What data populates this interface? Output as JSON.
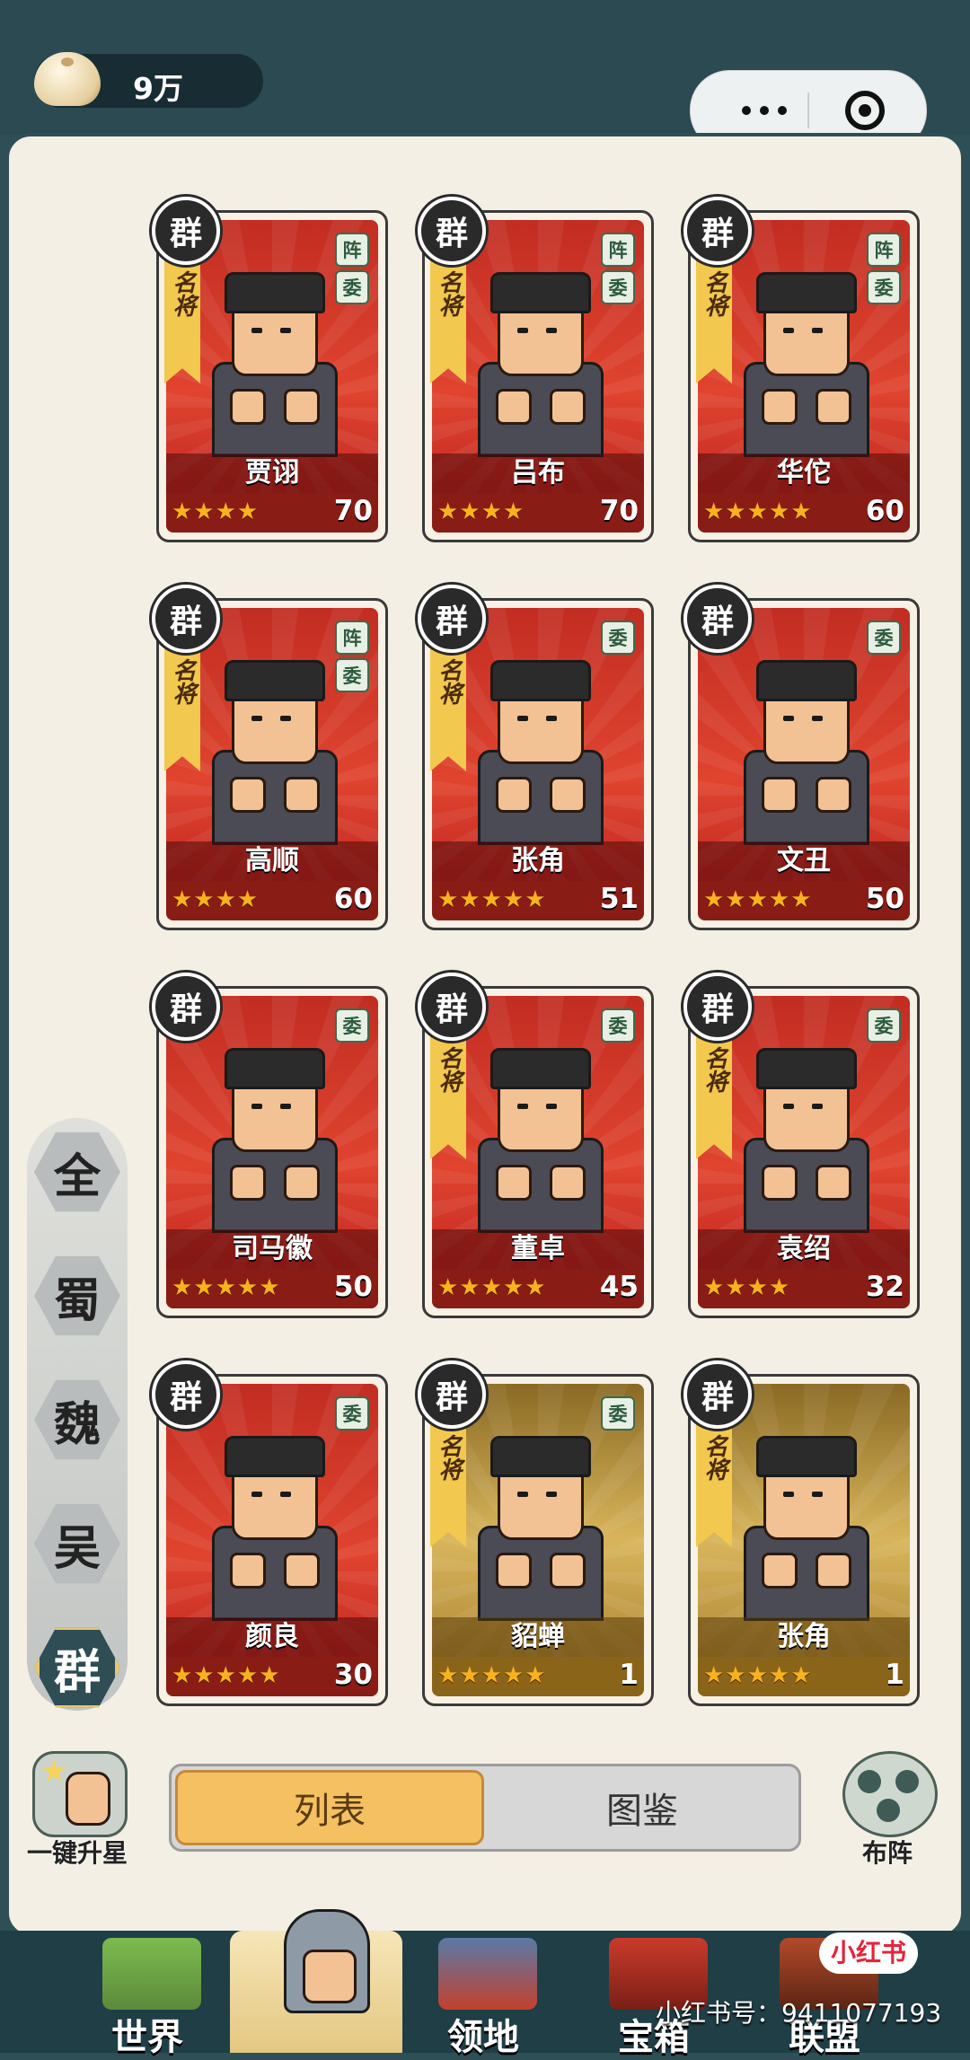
{
  "currency": {
    "value": "9万",
    "icon": "bun-icon"
  },
  "capsule": {
    "more_icon": "more-dots-icon",
    "close_icon": "target-close-icon"
  },
  "cards": [
    {
      "faction": "群",
      "ribbon": "名将",
      "tags": [
        "阵",
        "委"
      ],
      "name": "贾诩",
      "stars": "★★★★",
      "level": "70",
      "theme": "red"
    },
    {
      "faction": "群",
      "ribbon": "名将",
      "tags": [
        "阵",
        "委"
      ],
      "name": "吕布",
      "stars": "★★★★",
      "level": "70",
      "theme": "red"
    },
    {
      "faction": "群",
      "ribbon": "名将",
      "tags": [
        "阵",
        "委"
      ],
      "name": "华佗",
      "stars": "★★★★★",
      "level": "60",
      "theme": "red"
    },
    {
      "faction": "群",
      "ribbon": "名将",
      "tags": [
        "阵",
        "委"
      ],
      "name": "高顺",
      "stars": "★★★★",
      "level": "60",
      "theme": "red"
    },
    {
      "faction": "群",
      "ribbon": "名将",
      "tags": [
        "委"
      ],
      "name": "张角",
      "stars": "★★★★★",
      "level": "51",
      "theme": "red"
    },
    {
      "faction": "群",
      "ribbon": "",
      "tags": [
        "委"
      ],
      "name": "文丑",
      "stars": "★★★★★",
      "level": "50",
      "theme": "red"
    },
    {
      "faction": "群",
      "ribbon": "",
      "tags": [
        "委"
      ],
      "name": "司马徽",
      "stars": "★★★★★",
      "level": "50",
      "theme": "red"
    },
    {
      "faction": "群",
      "ribbon": "名将",
      "tags": [
        "委"
      ],
      "name": "董卓",
      "stars": "★★★★★",
      "level": "45",
      "theme": "red"
    },
    {
      "faction": "群",
      "ribbon": "名将",
      "tags": [
        "委"
      ],
      "name": "袁绍",
      "stars": "★★★★",
      "level": "32",
      "theme": "red"
    },
    {
      "faction": "群",
      "ribbon": "",
      "tags": [
        "委"
      ],
      "name": "颜良",
      "stars": "★★★★★",
      "level": "30",
      "theme": "red"
    },
    {
      "faction": "群",
      "ribbon": "名将",
      "tags": [
        "委"
      ],
      "name": "貂蝉",
      "stars": "★★★★★",
      "level": "1",
      "theme": "gold"
    },
    {
      "faction": "群",
      "ribbon": "名将",
      "tags": [],
      "name": "张角",
      "stars": "★★★★★",
      "level": "1",
      "theme": "gold"
    }
  ],
  "side_tabs": [
    {
      "label": "全",
      "active": false
    },
    {
      "label": "蜀",
      "active": false
    },
    {
      "label": "魏",
      "active": false
    },
    {
      "label": "吴",
      "active": false
    },
    {
      "label": "群",
      "active": true
    }
  ],
  "view_toggle": {
    "list": "列表",
    "gallery": "图鉴",
    "selected": "列表"
  },
  "upgrade_stars": {
    "label": "一键升星",
    "icon": "upgrade-star-icon"
  },
  "formation": {
    "label": "布阵",
    "icon": "formation-icon"
  },
  "bottom_nav": [
    {
      "label": "世界",
      "active": false
    },
    {
      "label": "",
      "active": true
    },
    {
      "label": "领地",
      "active": false
    },
    {
      "label": "宝箱",
      "active": false
    },
    {
      "label": "联盟",
      "active": false
    }
  ],
  "watermark": {
    "badge": "小红书",
    "text": "小红书号：9411077193"
  }
}
